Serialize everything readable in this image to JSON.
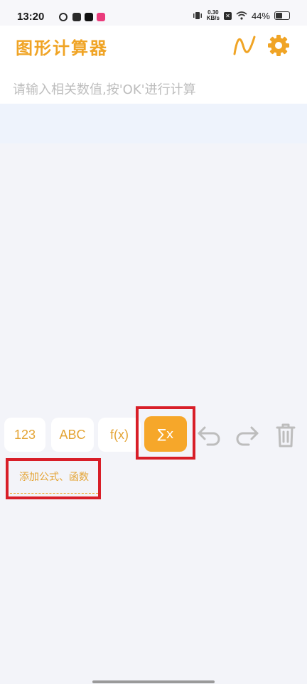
{
  "status_bar": {
    "time": "13:20",
    "net_speed_value": "0.30",
    "net_speed_unit": "KB/s",
    "battery": "44%",
    "icons": [
      "notif-icon",
      "mail-icon",
      "tiktok-icon",
      "app-icon",
      "vibrate-icon",
      "x-icon",
      "wifi-icon",
      "battery-icon"
    ]
  },
  "header": {
    "title": "图形计算器",
    "graph_icon": "graph-icon",
    "settings_icon": "gear-icon"
  },
  "input": {
    "placeholder": "请输入相关数值,按'OK'进行计算"
  },
  "keyboard": {
    "modes": [
      {
        "label": "123"
      },
      {
        "label": "ABC"
      },
      {
        "label": "f(x)"
      },
      {
        "label": "∑x"
      }
    ],
    "active_mode": "∑x",
    "actions": [
      "undo-icon",
      "redo-icon",
      "trash-icon"
    ]
  },
  "tooltip": {
    "text": "添加公式、函数"
  },
  "colors": {
    "accent": "#f0a425",
    "active_key": "#f6a72a",
    "highlight": "#d81e28",
    "background": "#f3f4f9"
  }
}
